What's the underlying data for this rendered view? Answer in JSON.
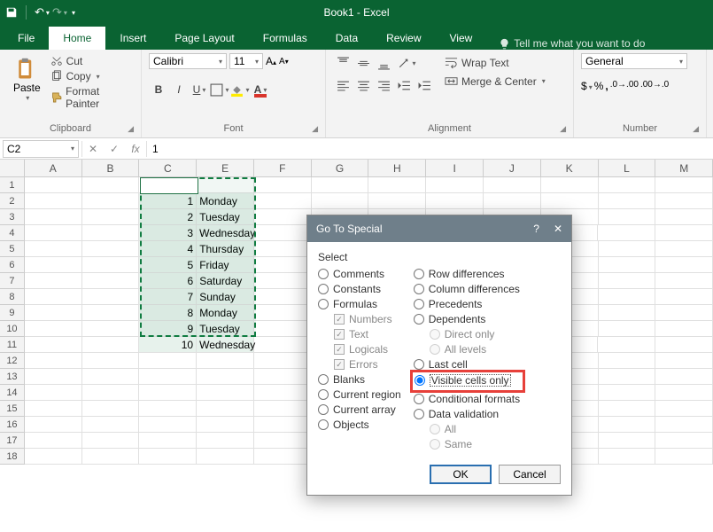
{
  "titlebar": {
    "title": "Book1 - Excel"
  },
  "tabs": [
    "File",
    "Home",
    "Insert",
    "Page Layout",
    "Formulas",
    "Data",
    "Review",
    "View"
  ],
  "active_tab": "Home",
  "tellme": "Tell me what you want to do",
  "clipboard": {
    "paste": "Paste",
    "cut": "Cut",
    "copy": "Copy",
    "fp": "Format Painter",
    "label": "Clipboard"
  },
  "font": {
    "name": "Calibri",
    "size": "11",
    "label": "Font"
  },
  "alignment": {
    "wrap": "Wrap Text",
    "merge": "Merge & Center",
    "label": "Alignment"
  },
  "number": {
    "format": "General",
    "label": "Number"
  },
  "namebox": "C2",
  "formula": "1",
  "columns": [
    "A",
    "B",
    "C",
    "E",
    "F",
    "G",
    "H",
    "I",
    "J",
    "K",
    "L",
    "M"
  ],
  "rowcount": 18,
  "cells": {
    "2": {
      "C": "1",
      "E": "Monday"
    },
    "3": {
      "C": "2",
      "E": "Tuesday"
    },
    "4": {
      "C": "3",
      "E": "Wednesday"
    },
    "5": {
      "C": "4",
      "E": "Thursday"
    },
    "6": {
      "C": "5",
      "E": "Friday"
    },
    "7": {
      "C": "6",
      "E": "Saturday"
    },
    "8": {
      "C": "7",
      "E": "Sunday"
    },
    "9": {
      "C": "8",
      "E": "Monday"
    },
    "10": {
      "C": "9",
      "E": "Tuesday"
    },
    "11": {
      "C": "10",
      "E": "Wednesday"
    }
  },
  "dialog": {
    "title": "Go To Special",
    "section": "Select",
    "help": "?",
    "left": [
      "Comments",
      "Constants",
      "Formulas"
    ],
    "sub": [
      "Numbers",
      "Text",
      "Logicals",
      "Errors"
    ],
    "left2": [
      "Blanks",
      "Current region",
      "Current array",
      "Objects"
    ],
    "right": [
      "Row differences",
      "Column differences",
      "Precedents",
      "Dependents"
    ],
    "subr": [
      "Direct only",
      "All levels"
    ],
    "right2": [
      "Last cell",
      "Visible cells only",
      "Conditional formats",
      "Data validation"
    ],
    "subr2": [
      "All",
      "Same"
    ],
    "selected": "Visible cells only",
    "ok": "OK",
    "cancel": "Cancel"
  }
}
